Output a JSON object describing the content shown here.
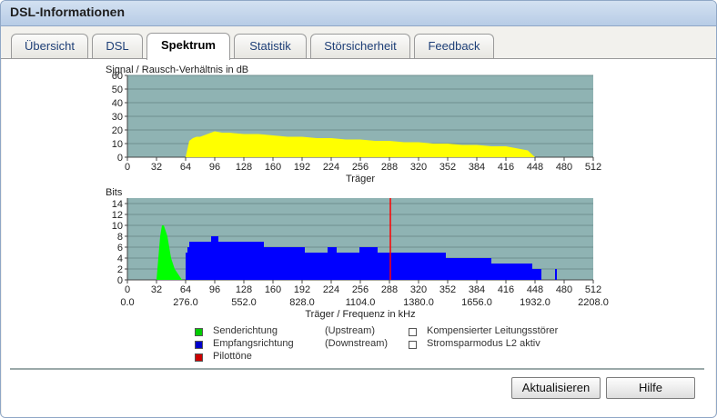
{
  "window": {
    "title": "DSL-Informationen"
  },
  "tabs": [
    {
      "label": "Übersicht",
      "active": false
    },
    {
      "label": "DSL",
      "active": false
    },
    {
      "label": "Spektrum",
      "active": true
    },
    {
      "label": "Statistik",
      "active": false
    },
    {
      "label": "Störsicherheit",
      "active": false
    },
    {
      "label": "Feedback",
      "active": false
    }
  ],
  "chart_data": [
    {
      "type": "area",
      "title": "Signal / Rausch-Verhältnis in dB",
      "xlabel": "Träger",
      "ylabel": "",
      "xlim": [
        0,
        512
      ],
      "ylim": [
        0,
        60
      ],
      "xticks": [
        "0",
        "32",
        "64",
        "96",
        "128",
        "160",
        "192",
        "224",
        "256",
        "288",
        "320",
        "352",
        "384",
        "416",
        "448",
        "480",
        "512"
      ],
      "yticks": [
        "0",
        "10",
        "20",
        "30",
        "40",
        "50",
        "60"
      ],
      "grid": true,
      "colors": {
        "background": "#8fb3b3",
        "fill": "#ffff00",
        "axes": "#555555"
      },
      "series": [
        {
          "x": [
            64,
            68,
            72,
            76,
            80,
            88,
            96,
            104,
            112,
            128,
            144,
            160,
            176,
            192,
            208,
            224,
            240,
            256,
            272,
            288,
            304,
            320,
            336,
            352,
            368,
            384,
            400,
            416,
            424,
            432,
            440,
            448
          ],
          "y": [
            0,
            12,
            14,
            15,
            15,
            17,
            19,
            18,
            18,
            17,
            17,
            16,
            15,
            15,
            14,
            14,
            13,
            13,
            12,
            12,
            11,
            11,
            10,
            10,
            9,
            9,
            8,
            8,
            7,
            6,
            5,
            0
          ]
        }
      ]
    },
    {
      "type": "bar",
      "title": "Bits",
      "xlabel": "Träger / Frequenz in kHz",
      "xlim": [
        0,
        512
      ],
      "ylim": [
        0,
        15
      ],
      "xticks": [
        "0",
        "32",
        "64",
        "96",
        "128",
        "160",
        "192",
        "224",
        "256",
        "288",
        "320",
        "352",
        "384",
        "416",
        "448",
        "480",
        "512"
      ],
      "yticks": [
        "0",
        "2",
        "4",
        "6",
        "8",
        "10",
        "12",
        "14"
      ],
      "freq_ticks": [
        "0.0",
        "276.0",
        "552.0",
        "828.0",
        "1104.0",
        "1380.0",
        "1656.0",
        "1932.0",
        "2208.0"
      ],
      "grid": true,
      "colors": {
        "background": "#8fb3b3",
        "upstream": "#00ff00",
        "downstream": "#0000ff",
        "pilot": "#ff0000",
        "axes": "#555555"
      },
      "upstream": {
        "x": [
          32,
          34,
          36,
          38,
          40,
          42,
          44,
          46,
          48,
          52,
          56,
          60
        ],
        "y": [
          0,
          4,
          8,
          10,
          10,
          9,
          8,
          6,
          4,
          2,
          1,
          0
        ]
      },
      "downstream": {
        "segments": [
          {
            "x0": 64,
            "x1": 66,
            "y": 5
          },
          {
            "x0": 66,
            "x1": 68,
            "y": 6
          },
          {
            "x0": 68,
            "x1": 92,
            "y": 7
          },
          {
            "x0": 92,
            "x1": 100,
            "y": 8
          },
          {
            "x0": 100,
            "x1": 150,
            "y": 7
          },
          {
            "x0": 150,
            "x1": 195,
            "y": 6
          },
          {
            "x0": 195,
            "x1": 220,
            "y": 5
          },
          {
            "x0": 220,
            "x1": 230,
            "y": 6
          },
          {
            "x0": 230,
            "x1": 255,
            "y": 5
          },
          {
            "x0": 255,
            "x1": 275,
            "y": 6
          },
          {
            "x0": 275,
            "x1": 350,
            "y": 5
          },
          {
            "x0": 350,
            "x1": 400,
            "y": 4
          },
          {
            "x0": 400,
            "x1": 420,
            "y": 3
          },
          {
            "x0": 420,
            "x1": 445,
            "y": 3
          },
          {
            "x0": 445,
            "x1": 455,
            "y": 2
          },
          {
            "x0": 470,
            "x1": 472,
            "y": 2
          }
        ]
      },
      "pilot": {
        "x": 289,
        "y": 15
      }
    }
  ],
  "legend": {
    "items": [
      {
        "label": "Senderichtung",
        "direction": "(Upstream)",
        "color": "#00cc00"
      },
      {
        "label": "Empfangsrichtung",
        "direction": "(Downstream)",
        "color": "#0000cc"
      },
      {
        "label": "Pilottöne",
        "direction": "",
        "color": "#cc0000"
      }
    ],
    "checkbox_items": [
      {
        "label": "Kompensierter Leitungsstörer"
      },
      {
        "label": "Stromsparmodus L2 aktiv"
      }
    ]
  },
  "buttons": {
    "refresh": "Aktualisieren",
    "help": "Hilfe"
  }
}
